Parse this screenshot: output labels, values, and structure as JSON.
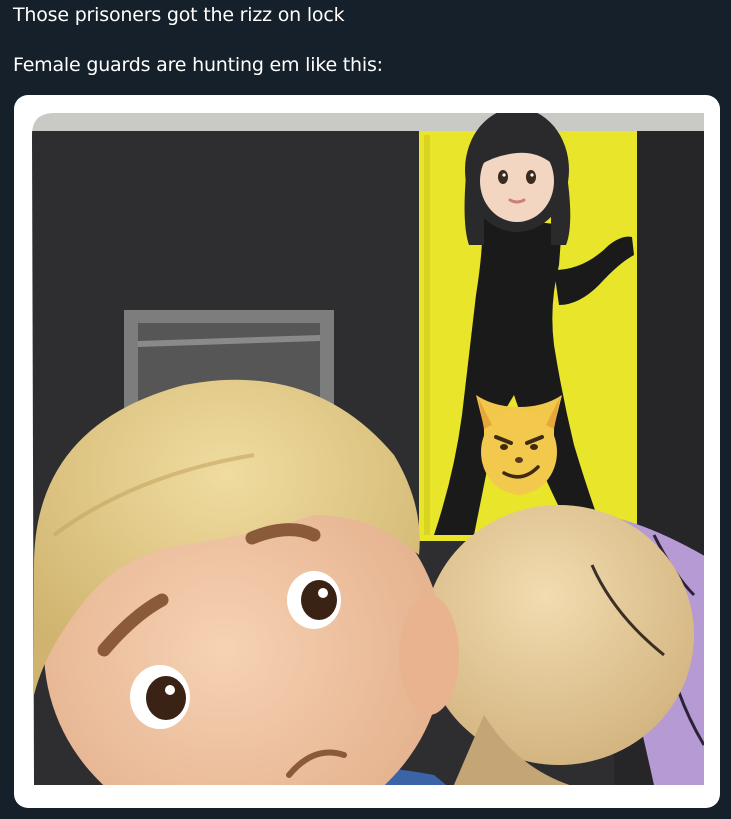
{
  "tweet": {
    "line1": "Those prisoners got the rizz on lock",
    "line2": "Female guards are hunting em like this:"
  },
  "media": {
    "icons": {
      "woman": "woman-emoji-icon",
      "cat": "smirking-cat-emoji-icon",
      "man": "worried-man-emoji-icon"
    },
    "colors": {
      "background": "#15202b",
      "card": "#ffffff",
      "wall": "#2d2d2f",
      "door_light": "#e6e42a",
      "skin": "#f1c7a3",
      "hair_blond": "#e6cf8c"
    }
  }
}
